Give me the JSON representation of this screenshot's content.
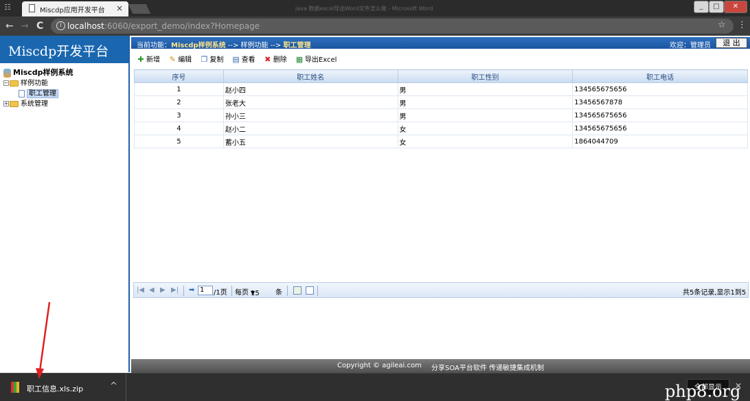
{
  "browser": {
    "tab_title": "Miscdp应用开发平台",
    "tab_close": "×",
    "window_title": "java 数据excel导出Word文件怎么做 - Microsoft Word",
    "url_host": "localhost",
    "url_rest": ":6060/export_demo/index?Homepage",
    "back": "←",
    "forward": "→",
    "reload": "C",
    "bookmark_star": "☆",
    "menu": "⋮"
  },
  "app": {
    "logo": "Miscdp开发平台",
    "breadcrumb_prefix": "当前功能：",
    "breadcrumb_system": "Miscdp样例系统",
    "breadcrumb_sep1": " --> ",
    "breadcrumb_module": "样例功能",
    "breadcrumb_sep2": " --> ",
    "breadcrumb_page": "职工管理",
    "welcome": "欢迎：管理员",
    "logout": "退 出"
  },
  "tree": {
    "root": "Miscdp样例系统",
    "items": [
      {
        "label": "样例功能",
        "toggle": "−"
      },
      {
        "label": "职工管理"
      },
      {
        "label": "系统管理",
        "toggle": "+"
      }
    ]
  },
  "toolbar": {
    "add": "新增",
    "edit": "编辑",
    "copy": "复制",
    "view": "查看",
    "delete": "删除",
    "export": "导出Excel"
  },
  "grid": {
    "columns": [
      "序号",
      "职工姓名",
      "职工性别",
      "职工电话"
    ],
    "rows": [
      [
        "1",
        "赵小四",
        "男",
        "134565675656"
      ],
      [
        "2",
        "张老大",
        "男",
        "13456567878"
      ],
      [
        "3",
        "孙小三",
        "男",
        "134565675656"
      ],
      [
        "4",
        "赵小二",
        "女",
        "134565675656"
      ],
      [
        "5",
        "蓄小五",
        "女",
        "1864044709"
      ]
    ]
  },
  "pager": {
    "first": "|◀",
    "prev": "◀",
    "next": "▶",
    "last": "▶|",
    "go": "➡",
    "page_value": "1",
    "page_total": "/1页",
    "per_page_label": "每页",
    "per_page_value": "15",
    "per_page_unit": "条",
    "summary": "共5条记录,显示1到5"
  },
  "footer": {
    "copyright": "Copyright © agileai.com",
    "slogan": "分享SOA平台软件  传递敏捷集成机制"
  },
  "download": {
    "file_name": "职工信息.xls.zip",
    "show_all": "全部显示",
    "close": "✕"
  },
  "watermark": "php8.org",
  "colors": {
    "header_blue": "#1a67b0",
    "grid_header": "#c9dbf1",
    "footer_gray": "#5a5a5a"
  }
}
